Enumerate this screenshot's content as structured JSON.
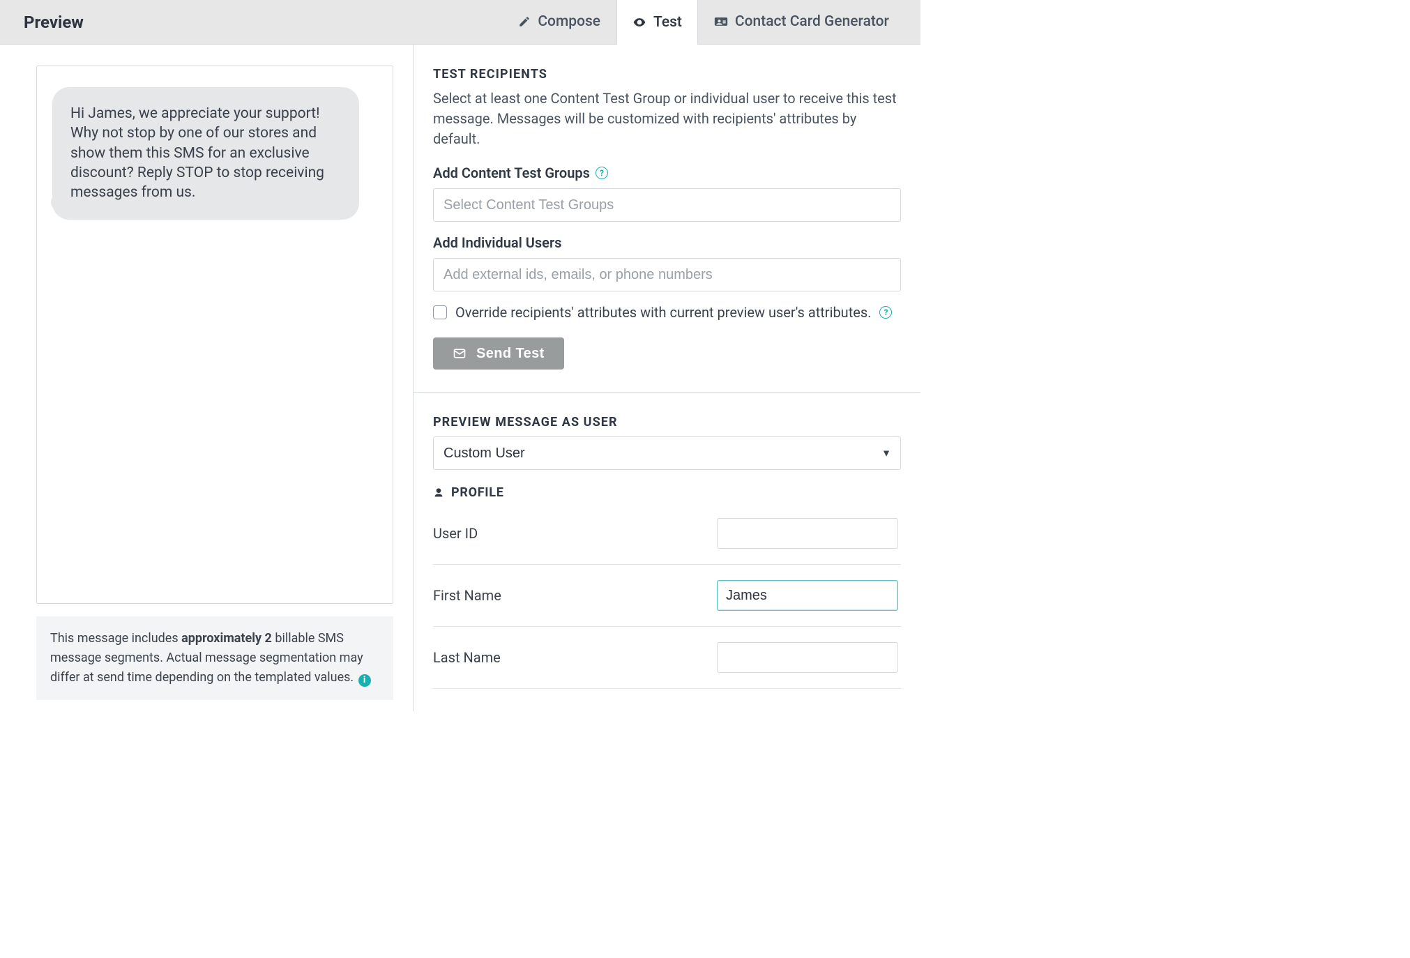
{
  "header": {
    "title": "Preview",
    "tabs": {
      "compose": "Compose",
      "test": "Test",
      "cardgen": "Contact Card Generator"
    }
  },
  "preview": {
    "bubble_text": "Hi James, we appreciate your support! Why not stop by one of our stores and show them this SMS for an exclusive discount? Reply STOP to stop receiving messages from us.",
    "segments_prefix": "This message includes ",
    "segments_bold": "approximately 2",
    "segments_suffix": " billable SMS message segments. Actual message segmentation may differ at send time depending on the templated values."
  },
  "test_recipients": {
    "title": "TEST RECIPIENTS",
    "description": "Select at least one Content Test Group or individual user to receive this test message. Messages will be customized with recipients' attributes by default.",
    "groups_label": "Add Content Test Groups",
    "groups_placeholder": "Select Content Test Groups",
    "users_label": "Add Individual Users",
    "users_placeholder": "Add external ids, emails, or phone numbers",
    "override_label": "Override recipients' attributes with current preview user's attributes.",
    "send_button": "Send Test"
  },
  "preview_as": {
    "title": "PREVIEW MESSAGE AS USER",
    "select_value": "Custom User",
    "profile_title": "PROFILE",
    "fields": {
      "user_id": {
        "label": "User ID",
        "value": ""
      },
      "first_name": {
        "label": "First Name",
        "value": "James"
      },
      "last_name": {
        "label": "Last Name",
        "value": ""
      }
    }
  }
}
